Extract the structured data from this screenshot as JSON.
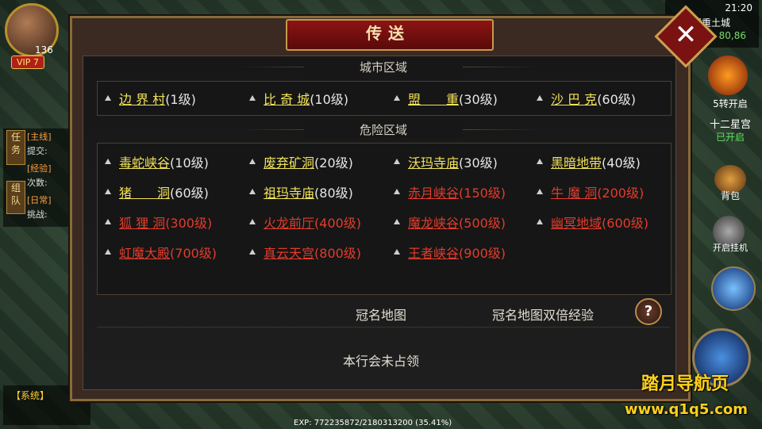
{
  "dialog": {
    "title": "传送",
    "close_label": "✕",
    "city_section": "城市区域",
    "danger_section": "危险区域",
    "city_locations": [
      {
        "name": "边 界 村",
        "level": "(1级)",
        "color": "yellow"
      },
      {
        "name": "比 奇 城",
        "level": "(10级)",
        "color": "yellow"
      },
      {
        "name": "盟　　重",
        "level": "(30级)",
        "color": "yellow"
      },
      {
        "name": "沙 巴 克",
        "level": "(60级)",
        "color": "yellow"
      }
    ],
    "danger_locations": [
      {
        "name": "毒蛇峡谷",
        "level": "(10级)",
        "color": "yellow"
      },
      {
        "name": "废弃矿洞",
        "level": "(20级)",
        "color": "yellow"
      },
      {
        "name": "沃玛寺庙",
        "level": "(30级)",
        "color": "yellow"
      },
      {
        "name": "黑暗地带",
        "level": "(40级)",
        "color": "yellow"
      },
      {
        "name": "猪　　洞",
        "level": "(60级)",
        "color": "yellow"
      },
      {
        "name": "祖玛寺庙",
        "level": "(80级)",
        "color": "yellow"
      },
      {
        "name": "赤月峡谷",
        "level": "(150级)",
        "color": "red"
      },
      {
        "name": "牛 魔 洞",
        "level": "(200级)",
        "color": "red"
      },
      {
        "name": "狐 狸 洞",
        "level": "(300级)",
        "color": "red"
      },
      {
        "name": "火龙前厅",
        "level": "(400级)",
        "color": "red"
      },
      {
        "name": "魔龙峡谷",
        "level": "(500级)",
        "color": "red"
      },
      {
        "name": "幽冥地域",
        "level": "(600级)",
        "color": "red"
      },
      {
        "name": "虹魔大殿",
        "level": "(700级)",
        "color": "red"
      },
      {
        "name": "真云天宫",
        "level": "(800级)",
        "color": "red"
      },
      {
        "name": "王者峡谷",
        "level": "(900级)",
        "color": "red"
      }
    ],
    "crown_map_label": "冠名地图",
    "crown_map_exp_label": "冠名地图双倍经验",
    "help_label": "?",
    "guild_status": "本行会未占领"
  },
  "hud": {
    "level": "136",
    "vip": "VIP 7",
    "clock": "21:20",
    "map_name": "盟重土城",
    "coords": "80,86",
    "transfer_hint": "5转开启",
    "constellation": "十二星宫",
    "constellation_status": "已开启",
    "bag_label": "背包",
    "auto_label": "开启挂机",
    "quest_tab_1": "任务",
    "quest_tab_2": "组队",
    "quest_line_1": "[主线]",
    "quest_line_2": "提交:",
    "quest_line_3": "[经验]",
    "quest_line_4": "次数:",
    "quest_line_5": "[日常]",
    "quest_line_6": "挑战:",
    "chat_system": "【系统】",
    "exp_text": "EXP: 772235872/2180313200 (35.41%)"
  },
  "watermark": {
    "line1": "踏月导航页",
    "line2": "www.q1q5.com"
  },
  "colors": {
    "yellow_link": "#f2e35a",
    "red_link": "#e33c2c",
    "title_red": "#8c1414"
  }
}
